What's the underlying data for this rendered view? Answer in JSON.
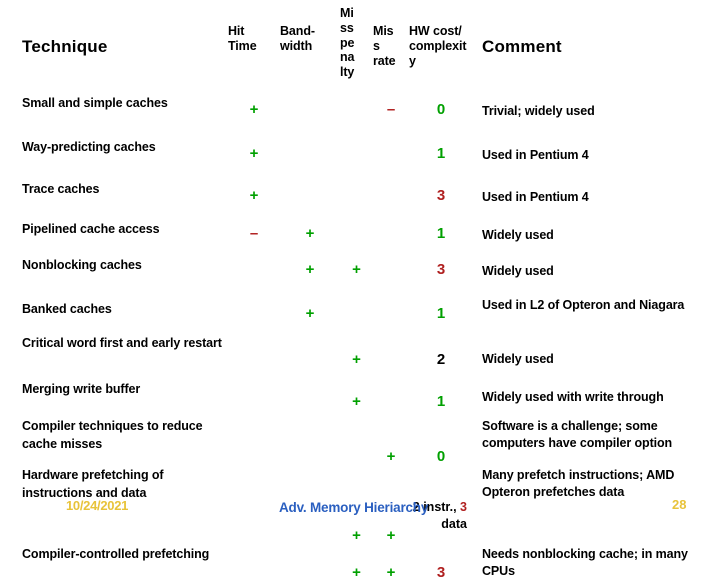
{
  "slide": {
    "footer_title": "Adv. Memory Hieriarchy",
    "date_stamp": "10/24/2021",
    "page_number": "28",
    "colors": {
      "positive": "#00a000",
      "negative": "#b02020",
      "neutral": "#000000",
      "footer_title": "#2a5fc0",
      "stamp": "#e8c33a"
    }
  },
  "table": {
    "headers": {
      "technique": "Technique",
      "hit_time": "Hit\nTime",
      "bandwidth": "Band-\nwidth",
      "miss_penalty": "Mi\nss\npe\nna\nlty",
      "miss_rate": "Mis\ns\nrate",
      "hw_cost": "HW cost/\ncomplexit\ny",
      "comment": "Comment"
    },
    "rows": [
      {
        "technique": "Small and simple caches",
        "hit_time": "+",
        "bandwidth": "",
        "miss_penalty": "",
        "miss_rate": "–",
        "hw_cost": "0",
        "hw_cost_color": "green",
        "comment": "Trivial; widely used"
      },
      {
        "technique": "Way-predicting caches",
        "hit_time": "+",
        "bandwidth": "",
        "miss_penalty": "",
        "miss_rate": "",
        "hw_cost": "1",
        "hw_cost_color": "green",
        "comment": "Used in Pentium 4"
      },
      {
        "technique": "Trace caches",
        "hit_time": "+",
        "bandwidth": "",
        "miss_penalty": "",
        "miss_rate": "",
        "hw_cost": "3",
        "hw_cost_color": "red",
        "comment": "Used in Pentium 4"
      },
      {
        "technique": "Pipelined cache access",
        "hit_time": "–",
        "bandwidth": "+",
        "miss_penalty": "",
        "miss_rate": "",
        "hw_cost": "1",
        "hw_cost_color": "green",
        "comment": "Widely used"
      },
      {
        "technique": "Nonblocking caches",
        "hit_time": "",
        "bandwidth": "+",
        "miss_penalty": "+",
        "miss_rate": "",
        "hw_cost": "3",
        "hw_cost_color": "red",
        "comment": "Widely used"
      },
      {
        "technique": "Banked caches",
        "hit_time": "",
        "bandwidth": "+",
        "miss_penalty": "",
        "miss_rate": "",
        "hw_cost": "1",
        "hw_cost_color": "green",
        "comment": "Used in L2 of Opteron and Niagara"
      },
      {
        "technique": "Critical word first and early restart",
        "hit_time": "",
        "bandwidth": "",
        "miss_penalty": "+",
        "miss_rate": "",
        "hw_cost": "2",
        "hw_cost_color": "black",
        "comment": "Widely used"
      },
      {
        "technique": "Merging write buffer",
        "hit_time": "",
        "bandwidth": "",
        "miss_penalty": "+",
        "miss_rate": "",
        "hw_cost": "1",
        "hw_cost_color": "green",
        "comment": "Widely used with write through"
      },
      {
        "technique": "Compiler techniques to reduce cache misses",
        "hit_time": "",
        "bandwidth": "",
        "miss_penalty": "",
        "miss_rate": "+",
        "hw_cost": "0",
        "hw_cost_color": "green",
        "comment": "Software is a challenge; some computers have compiler option"
      },
      {
        "technique": "Hardware prefetching of instructions and data",
        "hit_time": "",
        "bandwidth": "",
        "miss_penalty": "+",
        "miss_rate": "+",
        "hw_cost": "2 instr., 3 data",
        "hw_cost_prefix": "2 instr.,",
        "hw_cost_value": "3",
        "hw_cost_suffix": "data",
        "hw_cost_color": "red",
        "comment": "Many prefetch instructions; AMD Opteron prefetches data"
      },
      {
        "technique": "Compiler-controlled prefetching",
        "hit_time": "",
        "bandwidth": "",
        "miss_penalty": "+",
        "miss_rate": "+",
        "hw_cost": "3",
        "hw_cost_color": "red",
        "comment": "Needs nonblocking cache; in many CPUs"
      }
    ]
  }
}
